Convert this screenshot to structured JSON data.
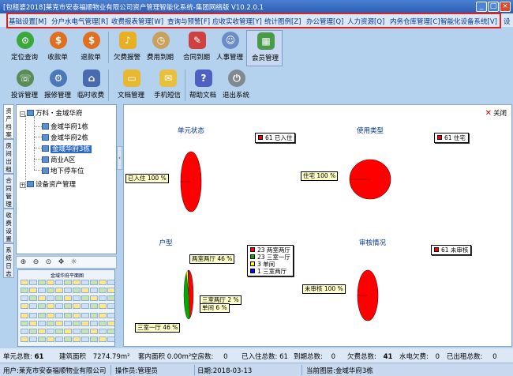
{
  "window": {
    "title": "[包租婆2018]莱克市安泰福顺物业有限公司资产管理智能化系统-集团网络版  V10.2.0.1",
    "min": "_",
    "max": "□",
    "close": "×"
  },
  "menu": [
    "基础设置[M]",
    "分户水电气管理[R]",
    "收费报表管理[W]",
    "查询与预警[F]",
    "应收实收管理[Y]",
    "统计图例[Z]",
    "办公管理[Q]",
    "人力资源[Q]",
    "内务仓库管理[C]",
    "智能化设备系统[V]",
    "设"
  ],
  "toolbar1": [
    {
      "label": "定位查询",
      "icon": "map-pin-icon",
      "color": "#3aa83a",
      "glyph": "⊙"
    },
    {
      "label": "收款单",
      "icon": "dollar-circle-icon",
      "color": "#e07020",
      "glyph": "$"
    },
    {
      "label": "退款单",
      "icon": "refund-circle-icon",
      "color": "#e07020",
      "glyph": "$"
    },
    {
      "label": "欠费报警",
      "icon": "alarm-bell-icon",
      "color": "#e8b020",
      "glyph": "♪"
    },
    {
      "label": "费用到期",
      "icon": "clock-icon",
      "color": "#c8a060",
      "glyph": "◷"
    },
    {
      "label": "合同到期",
      "icon": "contract-icon",
      "color": "#d04040",
      "glyph": "✎"
    },
    {
      "label": "人事管理",
      "icon": "people-icon",
      "color": "#6c8cc8",
      "glyph": "☺"
    },
    {
      "label": "会员管理",
      "icon": "members-icon",
      "color": "#4a9a4a",
      "glyph": "▦"
    }
  ],
  "toolbar2": [
    {
      "label": "投诉管理",
      "icon": "complaint-icon",
      "color": "#5a8c5a",
      "glyph": "☏"
    },
    {
      "label": "报修管理",
      "icon": "repair-icon",
      "color": "#4a78b8",
      "glyph": "⚙"
    },
    {
      "label": "临时收费",
      "icon": "house-fee-icon",
      "color": "#4a6ab0",
      "glyph": "⌂"
    },
    {
      "label": "文档管理",
      "icon": "folder-icon",
      "color": "#e8b830",
      "glyph": "▭"
    },
    {
      "label": "手机短信",
      "icon": "mail-icon",
      "color": "#e8c040",
      "glyph": "✉"
    },
    {
      "label": "帮助文档",
      "icon": "help-book-icon",
      "color": "#5060c0",
      "glyph": "?"
    },
    {
      "label": "退出系统",
      "icon": "exit-icon",
      "color": "#808890",
      "glyph": "⏻"
    }
  ],
  "side_tabs": [
    "资产档案",
    "房间出租",
    "合同管理",
    "收费设置",
    "系统日志"
  ],
  "tree": {
    "root": "万科・金域华府",
    "children": [
      "金域华府1栋",
      "金域华府2栋",
      "金域华府3栋",
      "商业A区",
      "地下停车位"
    ],
    "selected": "金域华府3栋",
    "other": "设备资产管理"
  },
  "map": {
    "title": "金域华府平面图",
    "tools": [
      "⊕",
      "⊖",
      "⊙",
      "✥",
      "☼"
    ]
  },
  "main": {
    "close_label": "关闭"
  },
  "chart_data": [
    {
      "type": "pie",
      "title": "单元状态",
      "slices": [
        {
          "label": "已入住",
          "value": 61,
          "color": "#ff0000"
        }
      ],
      "inner_label": "已入住 100 %",
      "legend": [
        "61 已入住"
      ]
    },
    {
      "type": "pie",
      "title": "使用类型",
      "slices": [
        {
          "label": "住宅",
          "value": 61,
          "color": "#ff0000"
        }
      ],
      "inner_label": "住宅 100 %",
      "legend": [
        "61 住宅"
      ]
    },
    {
      "type": "pie",
      "title": "户型",
      "slices": [
        {
          "label": "两室两厅",
          "value": 23,
          "color": "#ff0000"
        },
        {
          "label": "三室一厅",
          "value": 23,
          "color": "#00aa00"
        },
        {
          "label": "单间",
          "value": 3,
          "color": "#ffff00"
        },
        {
          "label": "三室两厅",
          "value": 1,
          "color": "#0000ff"
        }
      ],
      "inner_labels": [
        "两室两厅 46 %",
        "三室两厅 2 %",
        "单间 6 %",
        "三室一厅 46 %"
      ],
      "legend": [
        "23 两室两厅",
        "23 三室一厅",
        "3 单间",
        "1 三室两厅"
      ]
    },
    {
      "type": "pie",
      "title": "审核情况",
      "slices": [
        {
          "label": "未审核",
          "value": 61,
          "color": "#ff0000"
        }
      ],
      "inner_label": "未审核 100 %",
      "legend": [
        "61 未审核"
      ]
    }
  ],
  "status": {
    "units_label": "单元总数:",
    "units": "61",
    "area_label": "建筑面积",
    "area": "7274.79m²",
    "inner_label": "套内面积",
    "inner": "0.00m²",
    "vacant_label": "空房数:",
    "vacant": "0",
    "occupied_label": "已入住总数:",
    "occupied": "61",
    "due_label": "到期总数:",
    "due": "0",
    "arrears_label": "欠费总数:",
    "arrears": "41",
    "utility_label": "水电欠费:",
    "utility": "0",
    "rent_label": "已出租总数:",
    "rent": "0"
  },
  "bottom": {
    "user": "用户:莱克市安泰福顺物业有限公司",
    "operator": "操作员:管理员",
    "date": "日期:2018-03-13",
    "location": "当前图层:金域华府3栋"
  }
}
